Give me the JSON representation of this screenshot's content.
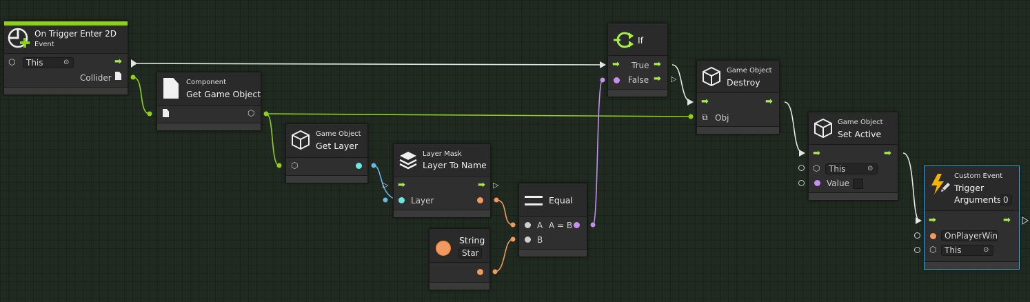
{
  "colors": {
    "flow": "#a6ee4e",
    "object": "#8fd11a",
    "layer": "#69b8e6",
    "string": "#f29a5d",
    "bool": "#c58ef0",
    "float": "#cfcfcf",
    "event_accent": "#8fd11a",
    "selected": "#4aa3c9"
  },
  "trigger": {
    "title": "On Trigger Enter 2D",
    "subtitle": "Event",
    "target": "This",
    "output": "Collider"
  },
  "getgo": {
    "subtitle": "Component",
    "title": "Get Game Object"
  },
  "getlayer": {
    "subtitle": "Game Object",
    "title": "Get Layer"
  },
  "layertoname": {
    "subtitle": "Layer Mask",
    "title": "Layer To Name",
    "input": "Layer"
  },
  "string": {
    "title": "String",
    "value": "Star"
  },
  "equal": {
    "title": "Equal",
    "a": "A",
    "ab": "A = B",
    "b": "B"
  },
  "ifnode": {
    "title": "If",
    "true_label": "True",
    "false_label": "False"
  },
  "destroy": {
    "subtitle": "Game Object",
    "title": "Destroy",
    "input": "Obj"
  },
  "setactive": {
    "subtitle": "Game Object",
    "title": "Set Active",
    "target": "This",
    "value_label": "Value"
  },
  "custom": {
    "subtitle": "Custom Event",
    "title": "Trigger",
    "args_label": "Arguments",
    "args_value": "0",
    "event_name": "OnPlayerWin",
    "target": "This"
  }
}
